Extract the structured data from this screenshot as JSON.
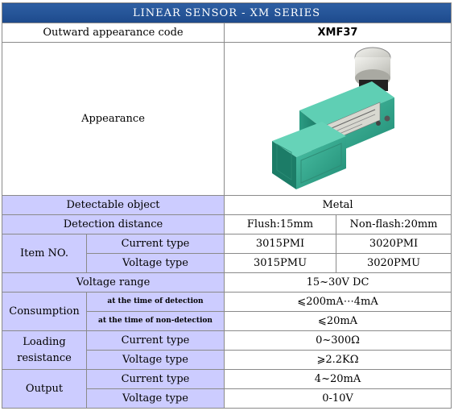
{
  "title": "LINEAR SENSOR - XM SERIES",
  "rows": {
    "code_label": "Outward appearance code",
    "code_value": "XMF37",
    "appearance_label": "Appearance",
    "object_label": "Detectable object",
    "object_value": "Metal",
    "distance_label": "Detection distance",
    "distance_flush": "Flush:15mm",
    "distance_nonflush": "Non-flash:20mm",
    "item_label": "Item NO.",
    "current_type": "Current type",
    "voltage_type": "Voltage type",
    "item_current_1": "3015PMI",
    "item_current_2": "3020PMI",
    "item_voltage_1": "3015PMU",
    "item_voltage_2": "3020PMU",
    "voltage_range_label": "Voltage range",
    "voltage_range_value": "15~30V DC",
    "consumption_label": "Consumption",
    "consumption_detect_label": "at the time of detection",
    "consumption_detect_value": "⩽200mA⋯4mA",
    "consumption_nondetect_label": "at the time of non-detection",
    "consumption_nondetect_value": "⩽20mA",
    "loading_label": "Loading resistance",
    "loading_current_value": "0~300Ω",
    "loading_voltage_value": "⩾2.2KΩ",
    "output_label": "Output",
    "output_current_value": "4~20mA",
    "output_voltage_value": "0-10V"
  },
  "colors": {
    "title_bg": "#1d4a8c",
    "label_bg": "#ccccff",
    "sensor_body": "#2aa38a",
    "sensor_face": "#3fb89e"
  },
  "image": {
    "icon": "proximity-sensor-photo"
  }
}
